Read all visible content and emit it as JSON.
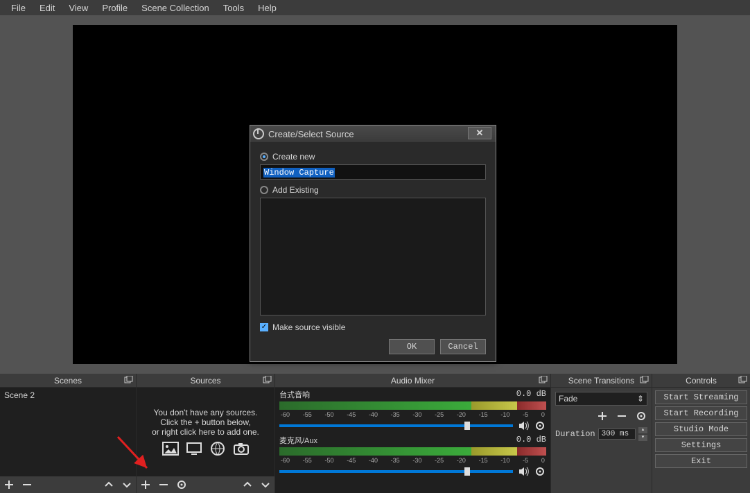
{
  "menu": {
    "file": "File",
    "edit": "Edit",
    "view": "View",
    "profile": "Profile",
    "scene_collection": "Scene Collection",
    "tools": "Tools",
    "help": "Help"
  },
  "docks": {
    "scenes_title": "Scenes",
    "sources_title": "Sources",
    "mixer_title": "Audio Mixer",
    "transitions_title": "Scene Transitions",
    "controls_title": "Controls"
  },
  "scenes": {
    "items": [
      "Scene 2"
    ]
  },
  "sources": {
    "empty_line1": "You don't have any sources.",
    "empty_line2": "Click the + button below,",
    "empty_line3": "or right click here to add one."
  },
  "mixer": {
    "channels": [
      {
        "name": "台式音响",
        "level": "0.0 dB"
      },
      {
        "name": "麦克风/Aux",
        "level": "0.0 dB"
      }
    ],
    "ticks": [
      "-60",
      "-55",
      "-50",
      "-45",
      "-40",
      "-35",
      "-30",
      "-25",
      "-20",
      "-15",
      "-10",
      "-5",
      "0"
    ]
  },
  "transitions": {
    "selected": "Fade",
    "duration_label": "Duration",
    "duration_value": "300 ms"
  },
  "controls": {
    "start_streaming": "Start Streaming",
    "start_recording": "Start Recording",
    "studio_mode": "Studio Mode",
    "settings": "Settings",
    "exit": "Exit"
  },
  "dialog": {
    "title": "Create/Select Source",
    "create_new": "Create new",
    "name_value": "Window Capture",
    "add_existing": "Add Existing",
    "make_visible": "Make source visible",
    "ok": "OK",
    "cancel": "Cancel"
  }
}
